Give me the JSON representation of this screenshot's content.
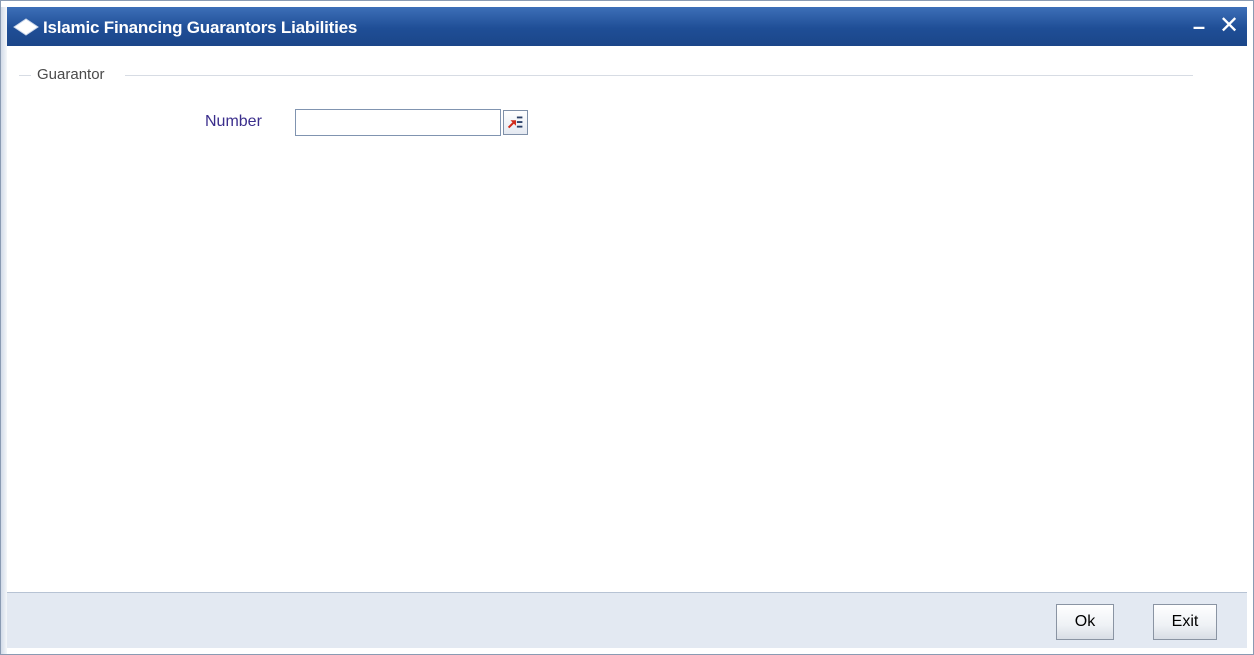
{
  "window": {
    "title": "Islamic Financing Guarantors Liabilities",
    "minimize_label": "–",
    "close_label": "✕"
  },
  "guarantor": {
    "legend": "Guarantor",
    "number_label": "Number",
    "number_value": ""
  },
  "footer": {
    "ok_label": "Ok",
    "exit_label": "Exit"
  },
  "colors": {
    "titlebar": "#1f4e96",
    "label": "#3b2e8c",
    "footer": "#e3e9f2"
  },
  "icons": {
    "title": "diamond-icon",
    "lov": "list-of-values-icon"
  }
}
